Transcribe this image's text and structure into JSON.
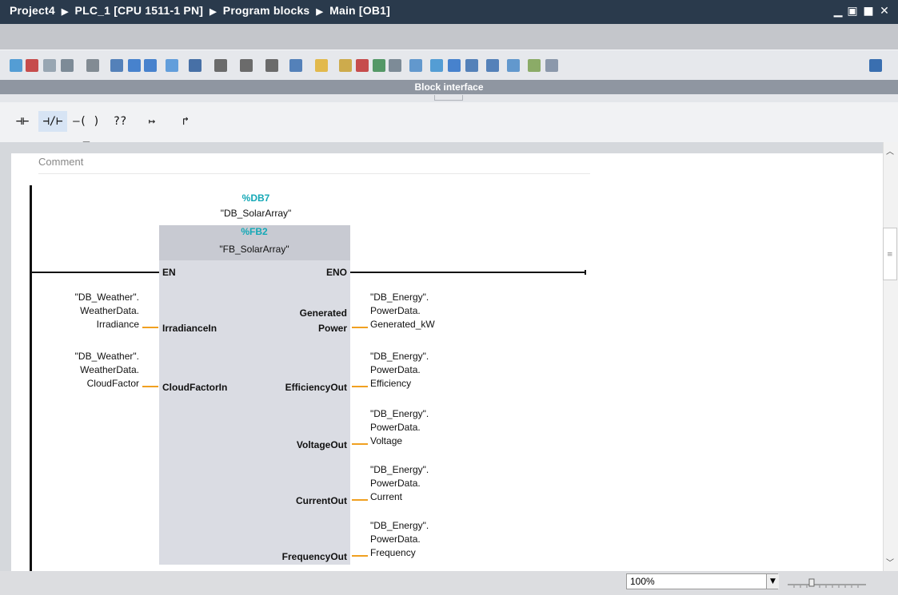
{
  "window": {
    "breadcrumb": [
      "Project4",
      "PLC_1 [CPU 1511-1 PN]",
      "Program blocks",
      "Main [OB1]"
    ],
    "controls": [
      "minimize",
      "restore",
      "float",
      "close"
    ]
  },
  "toolbar": {
    "icons": [
      "insert-network-icon",
      "delete-network-icon",
      "insert-row-icon",
      "add-row-icon",
      "absolute-operands-icon",
      "network-list-icon",
      "open-all-networks-icon",
      "close-all-networks-icon",
      "network-comments-icon",
      "favorites-icon",
      "shortcut-icon",
      "operand-display-icon",
      "symbol-info-icon",
      "callstack-icon",
      "monitoring-on-icon",
      "go-to-icon",
      "call-env-icon",
      "compare-icon",
      "reference-icon",
      "next-error-icon",
      "previous-error-icon",
      "monitor-icon",
      "test-icon",
      "watch-icon",
      "load-icon",
      "simulate-icon",
      "db-icon"
    ],
    "overflow_icon": "window-split-icon"
  },
  "block_interface": {
    "label": "Block interface"
  },
  "ladder_toolbar": {
    "items": [
      {
        "name": "normally-open-contact-icon",
        "glyph": "⊣⊢"
      },
      {
        "name": "normally-closed-contact-icon",
        "glyph": "⊣/⊢"
      },
      {
        "name": "coil-icon",
        "glyph": "—( )—"
      },
      {
        "name": "empty-box-icon",
        "glyph": "??"
      },
      {
        "name": "open-branch-icon",
        "glyph": "↦"
      },
      {
        "name": "close-branch-icon",
        "glyph": "↱"
      }
    ]
  },
  "network": {
    "comment_placeholder": "Comment",
    "instance_db": "%DB7",
    "instance_db_name": "\"DB_SolarArray\"",
    "fb_address": "%FB2",
    "fb_name": "\"FB_SolarArray\"",
    "en": "EN",
    "eno": "ENO",
    "inputs": [
      {
        "pin": "IrradianceIn",
        "operand": [
          "\"DB_Weather\".",
          "WeatherData.",
          "Irradiance"
        ]
      },
      {
        "pin": "CloudFactorIn",
        "operand": [
          "\"DB_Weather\".",
          "WeatherData.",
          "CloudFactor"
        ]
      }
    ],
    "outputs": [
      {
        "pin": [
          "Generated",
          "Power"
        ],
        "operand": [
          "\"DB_Energy\".",
          "PowerData.",
          "Generated_kW"
        ]
      },
      {
        "pin": [
          "EfficiencyOut"
        ],
        "operand": [
          "\"DB_Energy\".",
          "PowerData.",
          "Efficiency"
        ]
      },
      {
        "pin": [
          "VoltageOut"
        ],
        "operand": [
          "\"DB_Energy\".",
          "PowerData.",
          "Voltage"
        ]
      },
      {
        "pin": [
          "CurrentOut"
        ],
        "operand": [
          "\"DB_Energy\".",
          "PowerData.",
          "Current"
        ]
      },
      {
        "pin": [
          "FrequencyOut"
        ],
        "operand": [
          "\"DB_Energy\".",
          "PowerData.",
          "Frequency"
        ]
      }
    ]
  },
  "status": {
    "zoom": "100%"
  },
  "colors": {
    "titlebar": "#2a3a4c",
    "address": "#14a8b6",
    "wire": "#f0a020",
    "fbbox": "#dadce3",
    "fbheader": "#c8cad2"
  }
}
